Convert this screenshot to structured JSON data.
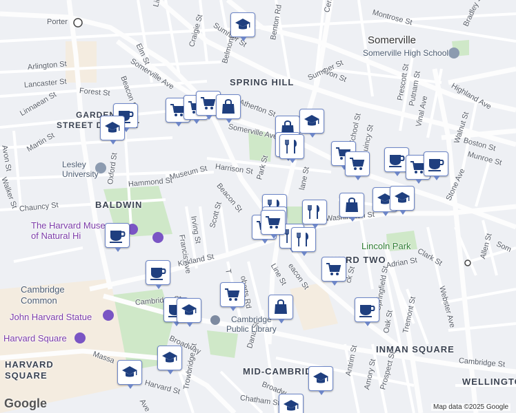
{
  "map": {
    "areas": [
      "SPRING HILL",
      "BALDWIN",
      "WARD TWO",
      "INMAN SQUARE",
      "MID-CAMBRIDGE",
      "HARVARD SQUARE",
      "WELLINGTON"
    ],
    "city": "Somerville",
    "historic_district": [
      "GARDEN",
      "STREET DISTRICT"
    ],
    "streets": {
      "porter": "Porter",
      "summer_st": "Summer St",
      "summer_st_2": "Summer St",
      "somerville_ave": "Somerville Ave",
      "somerville_ave_2": "Somerville Ave",
      "highland_ave": "Highland Ave",
      "beacon_st": "Beacon St",
      "beacon_st_2": "Beacon St",
      "beacon_st_3": "Beacon St",
      "beacon_st_4": "eacon St",
      "kirkland_st": "Kirkland St",
      "washington_st": "Washington St",
      "cambridge_st": "Cambridge St",
      "cambridge_st_2": "Cambridge St",
      "broadway": "Broadway",
      "broadway_2": "Broadw",
      "massachusetts": "Massa",
      "elm_st": "Elm St",
      "park_st": "Park St",
      "harrison_st": "Harrison St",
      "museum_st": "Museum St",
      "hammond_st": "Hammond St",
      "chauncy_st": "Chauncy St",
      "oxford_st": "Oxford St",
      "irving_st": "Irving St",
      "francis_ave": "Francis Ave",
      "scott_st": "Scott St",
      "avon_st": "Avon St",
      "avon_st_2": "Avon St",
      "arlington_st": "Arlington St",
      "lancaster_st": "Lancaster St",
      "forest_st": "Forest St",
      "linnaean_st": "Linnaean St",
      "martin_st": "Martin St",
      "walker_st": "Walker St",
      "linden_ave": "Linden Ave",
      "craigie_st": "Craigie St",
      "belmont_st": "Belmont St",
      "atherton_st": "Atherton St",
      "benton_rd": "Benton Rd",
      "central_st": "Central",
      "montrose_st": "Montrose St",
      "bradley_st": "Bradley St",
      "prescott_st": "Prescott St",
      "putnam_st": "Putnam St",
      "vinal_ave": "Vinal Ave",
      "walnut_st": "Walnut St",
      "boston_st": "Boston St",
      "munroe_st": "Munroe St",
      "stone_ave": "Stone Ave",
      "school_st": "School St",
      "quincy_st": "Quincy St",
      "lane_st": "lane St",
      "clark_st": "Clark St",
      "adrian_st": "Adrian St",
      "webster_ave": "Webster Ave",
      "allen_st": "Allen St",
      "somerville_edge": "Som",
      "line_st": "Line St",
      "roberts_rd": "oberts Rd",
      "trowbridge_st": "T",
      "springfield_st": "Springfield St",
      "oak_st": "Oak St",
      "tremont_st": "Tremont St",
      "dana_st": "Dana St",
      "antrim_st": "Antrim St",
      "amory_st": "Amory St",
      "prospect_st": "Prospect St",
      "chatham_st": "Chatham St",
      "trowbridge_st_2": "Trowbridge St",
      "harvard_st": "Harvard St",
      "ave": "Ave",
      "lock_st": "ck St",
      "norfolk_st": "St"
    },
    "pois": {
      "somerville_high": "Somerville High School",
      "lesley": "Lesley\nUniversity",
      "harvard_museum": "The Harvard Museum\nof Natural Hi",
      "cambridge_common": "Cambridge\nCommon",
      "john_harvard": "John Harvard Statue",
      "harvard_square": "Harvard Square",
      "library": "Cambridge\nPublic Library",
      "lincoln_park": "Lincoln Park"
    },
    "attribution": "Map data ©2025 Google",
    "logo": "Google",
    "markers": [
      {
        "icon": "school"
      },
      {
        "icon": "cart"
      },
      {
        "icon": "cart"
      },
      {
        "icon": "cart"
      },
      {
        "icon": "bag"
      },
      {
        "icon": "cup"
      },
      {
        "icon": "school"
      },
      {
        "icon": "bag"
      },
      {
        "icon": "school"
      },
      {
        "icon": "restaurant"
      },
      {
        "icon": "restaurant"
      },
      {
        "icon": "cart"
      },
      {
        "icon": "cart"
      },
      {
        "icon": "cup"
      },
      {
        "icon": "cart"
      },
      {
        "icon": "cup"
      },
      {
        "icon": "school"
      },
      {
        "icon": "school"
      },
      {
        "icon": "bag"
      },
      {
        "icon": "restaurant"
      },
      {
        "icon": "restaurant"
      },
      {
        "icon": "cart"
      },
      {
        "icon": "cart"
      },
      {
        "icon": "restaurant"
      },
      {
        "icon": "restaurant"
      },
      {
        "icon": "cup"
      },
      {
        "icon": "cup"
      },
      {
        "icon": "cart"
      },
      {
        "icon": "cart"
      },
      {
        "icon": "cup"
      },
      {
        "icon": "school"
      },
      {
        "icon": "bag"
      },
      {
        "icon": "cup"
      },
      {
        "icon": "school"
      },
      {
        "icon": "school"
      },
      {
        "icon": "school"
      },
      {
        "icon": "school"
      },
      {
        "icon": "cart"
      }
    ]
  }
}
